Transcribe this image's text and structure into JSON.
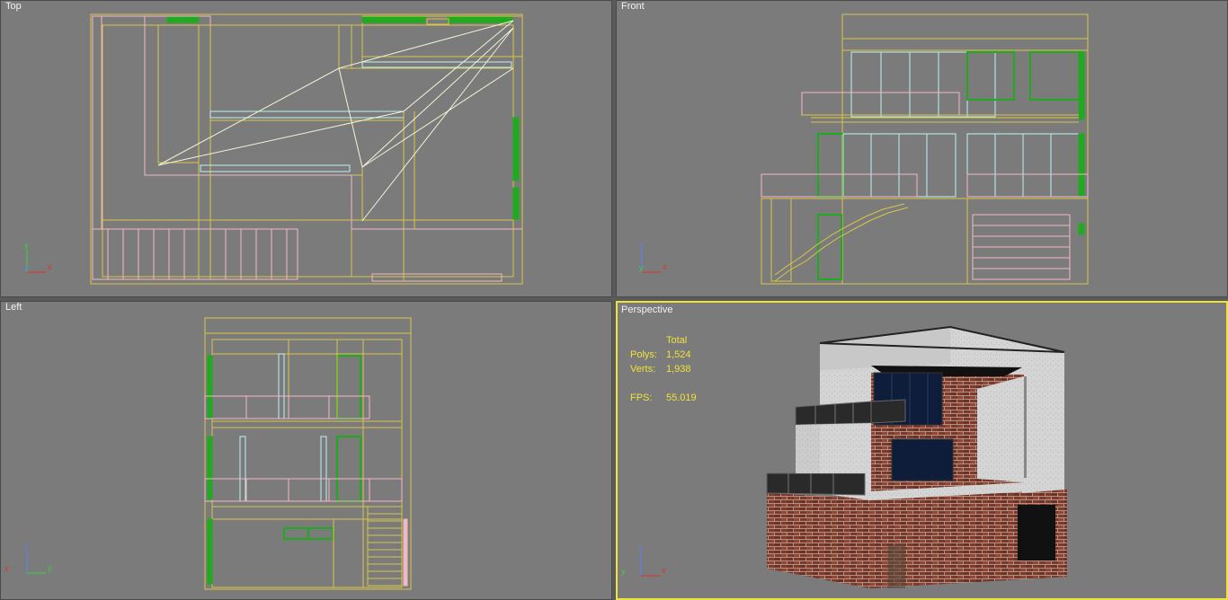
{
  "viewports": {
    "top": {
      "label": "Top"
    },
    "front": {
      "label": "Front"
    },
    "left": {
      "label": "Left"
    },
    "perspective": {
      "label": "Perspective"
    }
  },
  "stats": {
    "header": "Total",
    "polys_label": "Polys:",
    "polys_value": "1,524",
    "verts_label": "Verts:",
    "verts_value": "1,938",
    "fps_label": "FPS:",
    "fps_value": "55.019"
  },
  "axes": {
    "top": {
      "a": "y",
      "b": "x",
      "c": "z"
    },
    "front": {
      "a": "z",
      "b": "x",
      "c": "y"
    },
    "left": {
      "a": "z",
      "b": "y",
      "c": "x"
    },
    "persp": {
      "a": "z",
      "b": "x",
      "c": "y"
    }
  },
  "colors": {
    "active_border": "#f0e23c",
    "wire_yellow": "#d9c64a",
    "wire_pink": "#f0b8c4",
    "wire_green": "#1faa1f",
    "wire_cyan": "#bff0f5",
    "wire_white": "#f4f4d8"
  }
}
